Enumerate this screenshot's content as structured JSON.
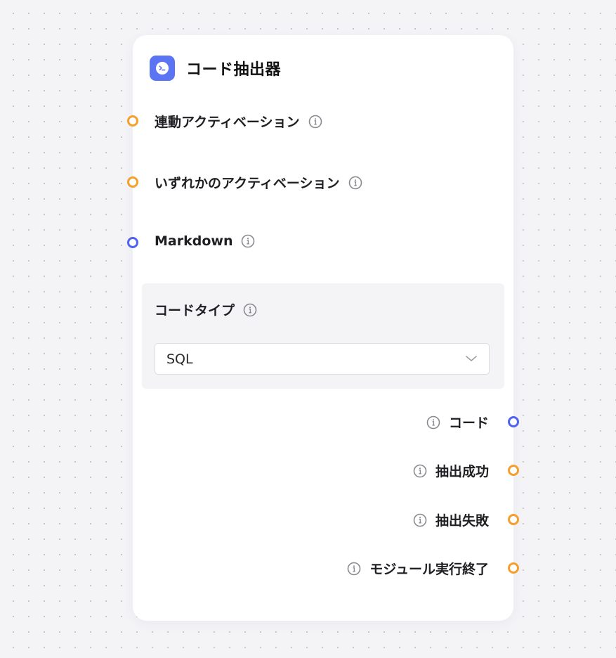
{
  "node": {
    "title": "コード抽出器",
    "icon": "terminal-icon",
    "accent_color": "#5b74f4"
  },
  "inputs": [
    {
      "label": "連動アクティベーション",
      "port_color": "#f5a02c"
    },
    {
      "label": "いずれかのアクティベーション",
      "port_color": "#f5a02c"
    },
    {
      "label": "Markdown",
      "port_color": "#4f63f0"
    }
  ],
  "param": {
    "label": "コードタイプ",
    "selected": "SQL"
  },
  "outputs": [
    {
      "label": "コード",
      "port_color": "#4f63f0"
    },
    {
      "label": "抽出成功",
      "port_color": "#f5a02c"
    },
    {
      "label": "抽出失敗",
      "port_color": "#f5a02c"
    },
    {
      "label": "モジュール実行終了",
      "port_color": "#f5a02c"
    }
  ]
}
